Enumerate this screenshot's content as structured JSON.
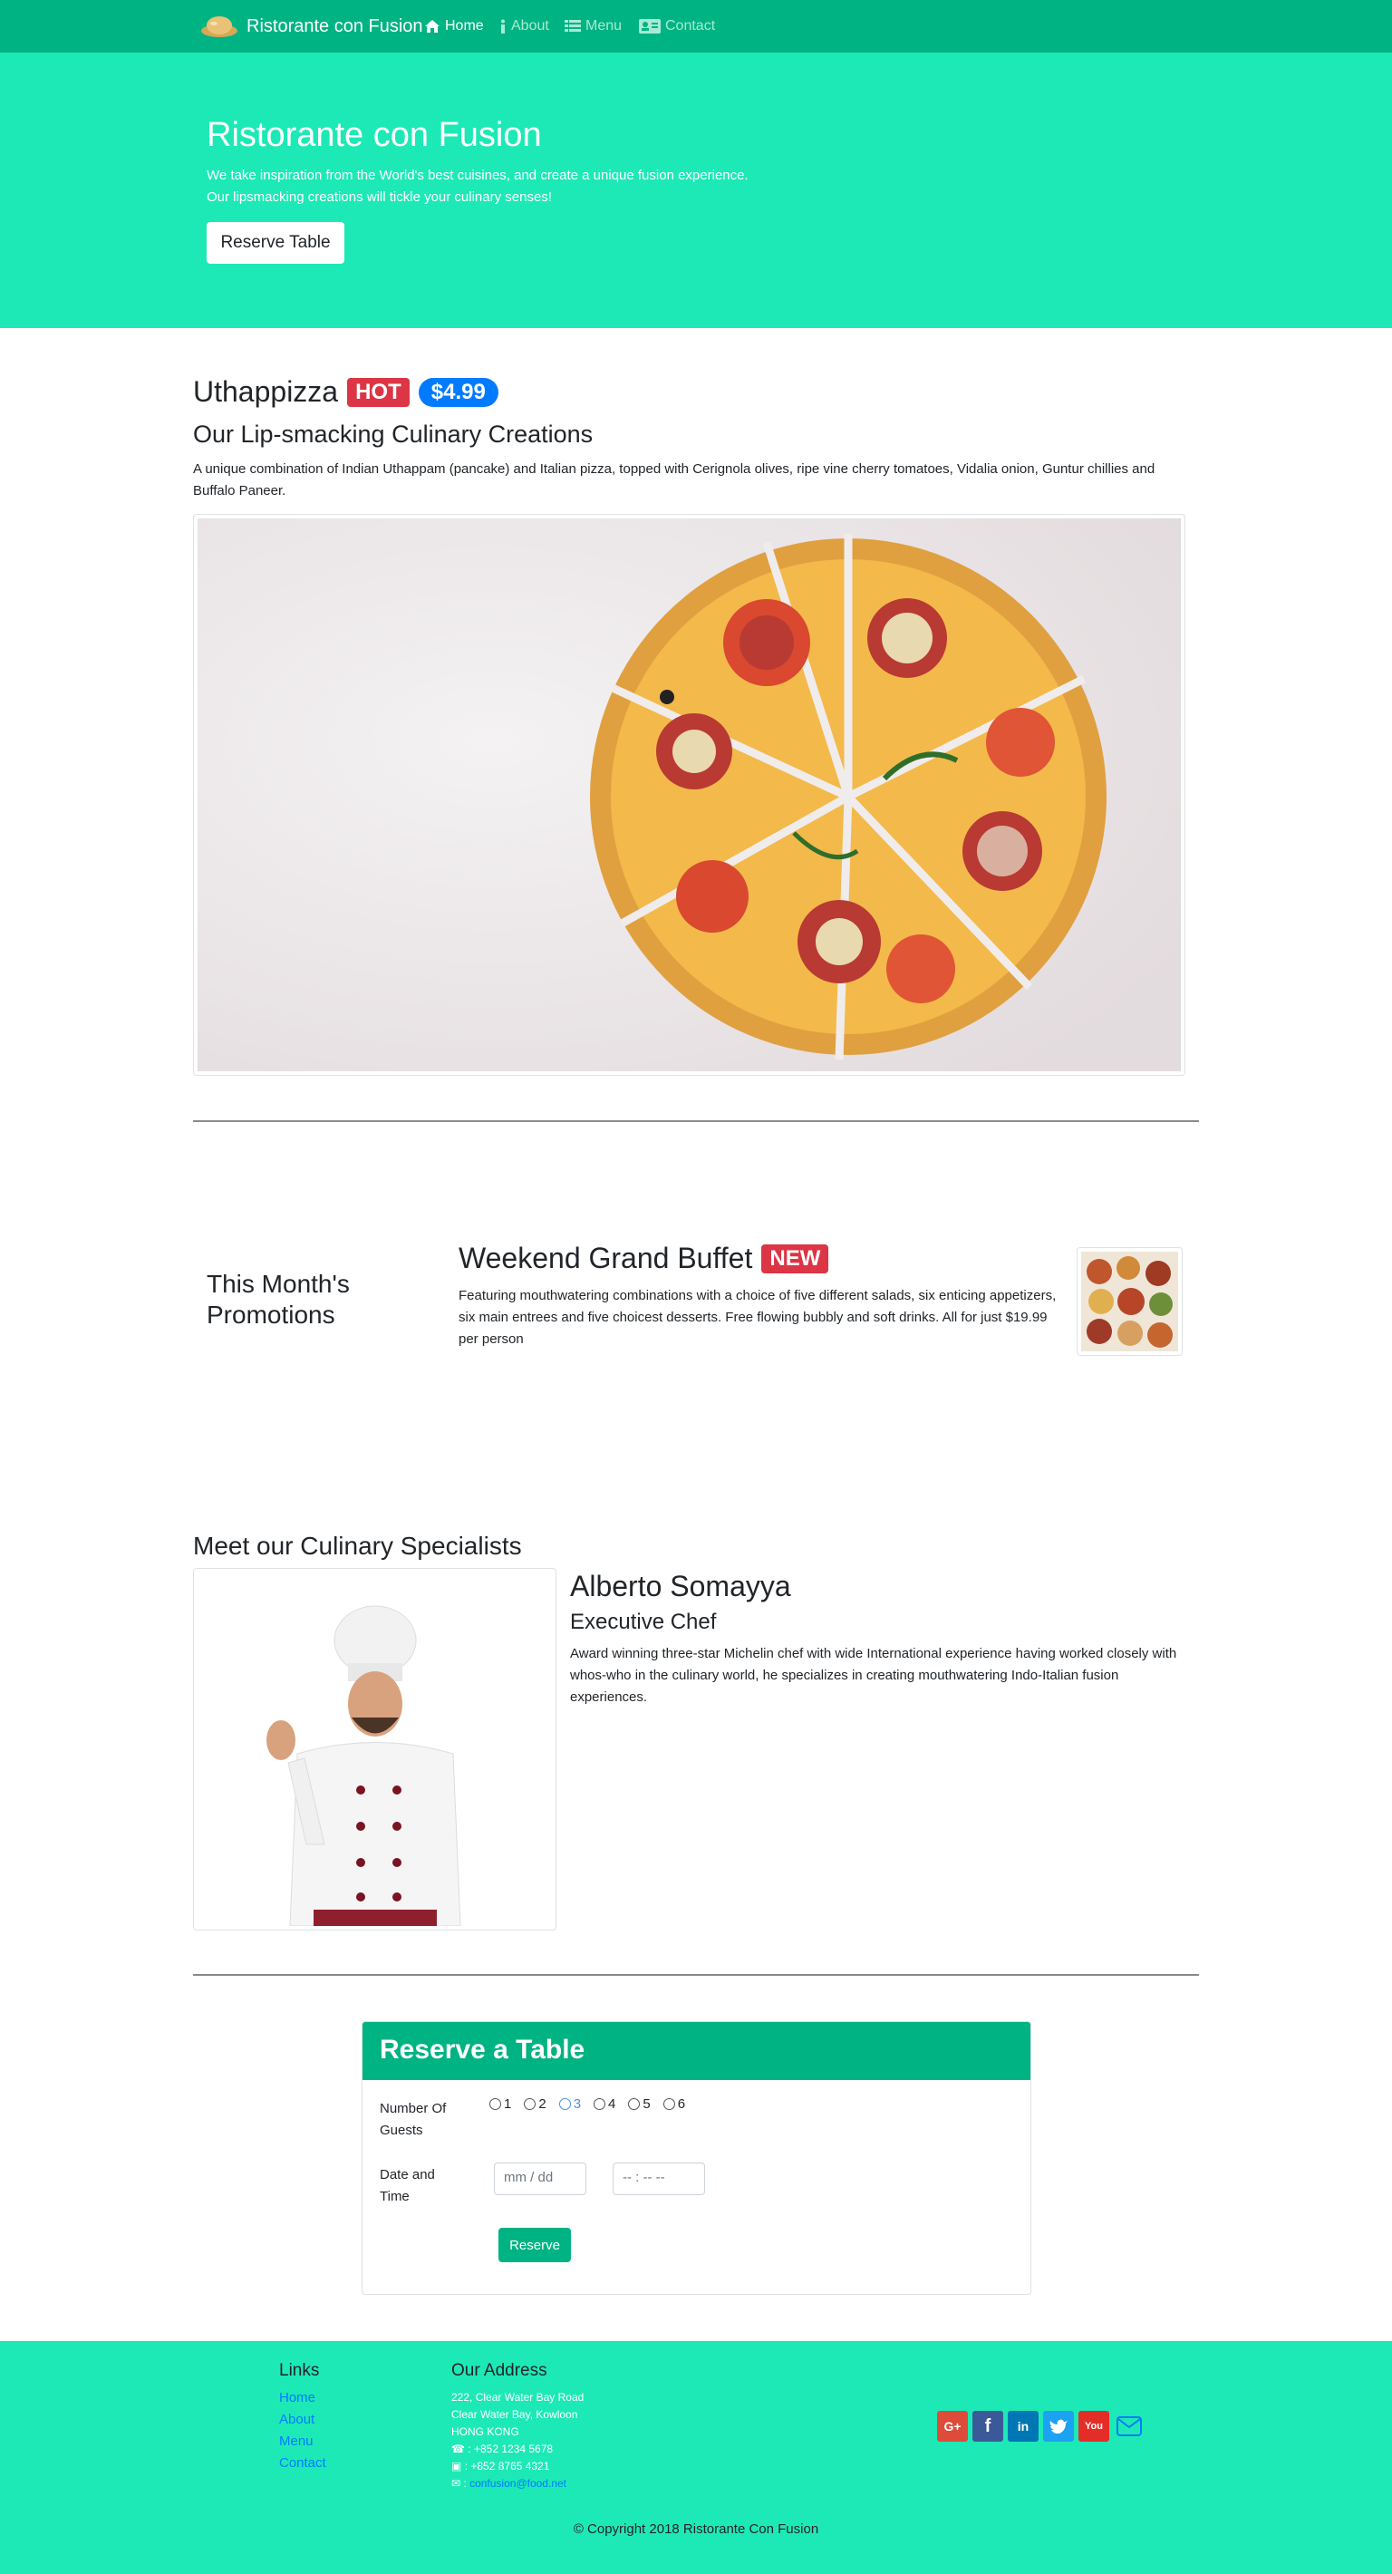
{
  "navbar": {
    "brand": "Ristorante con Fusion",
    "items": [
      {
        "label": "Home",
        "icon": "home-icon",
        "active": true
      },
      {
        "label": "About",
        "icon": "info-icon",
        "active": false
      },
      {
        "label": "Menu",
        "icon": "list-icon",
        "active": false
      },
      {
        "label": "Contact",
        "icon": "address-card-icon",
        "active": false
      }
    ]
  },
  "jumbotron": {
    "title": "Ristorante con Fusion",
    "line1": "We take inspiration from the World's best cuisines, and create a unique fusion experience.",
    "line2": "Our lipsmacking creations will tickle your culinary senses!",
    "button": "Reserve Table"
  },
  "dish": {
    "name": "Uthappizza",
    "badge": "HOT",
    "price": "$4.99",
    "subtitle": "Our Lip-smacking Culinary Creations",
    "description": "A unique combination of Indian Uthappam (pancake) and Italian pizza, topped with Cerignola olives, ripe vine cherry tomatoes, Vidalia onion, Guntur chillies and Buffalo Paneer."
  },
  "promotion": {
    "heading": "This Month's Promotions",
    "title": "Weekend Grand Buffet",
    "badge": "NEW",
    "description": "Featuring mouthwatering combinations with a choice of five different salads, six enticing appetizers, six main entrees and five choicest desserts. Free flowing bubbly and soft drinks. All for just $19.99 per person"
  },
  "chef": {
    "heading": "Meet our Culinary Specialists",
    "name": "Alberto Somayya",
    "role": "Executive Chef",
    "description": "Award winning three-star Michelin chef with wide International experience having worked closely with whos-who in the culinary world, he specializes in creating mouthwatering Indo-Italian fusion experiences."
  },
  "reserve": {
    "title": "Reserve a Table",
    "guests_label": "Number Of Guests",
    "guests": [
      "1",
      "2",
      "3",
      "4",
      "5",
      "6"
    ],
    "guests_selected": "3",
    "datetime_label": "Date and Time",
    "date_placeholder": "mm / dd",
    "time_placeholder": "-- : --   --",
    "submit": "Reserve"
  },
  "footer": {
    "links_heading": "Links",
    "links": [
      "Home",
      "About",
      "Menu",
      "Contact"
    ],
    "address_heading": "Our Address",
    "address": [
      "222, Clear Water Bay Road",
      "Clear Water Bay, Kowloon",
      "HONG KONG"
    ],
    "phone": ": +852 1234 5678",
    "fax": ": +852 8765 4321",
    "email": "confusion@food.net",
    "social": [
      "google-plus-icon",
      "facebook-icon",
      "linkedin-icon",
      "twitter-icon",
      "youtube-icon",
      "mail-icon"
    ],
    "copyright": "© Copyright 2018 Ristorante Con Fusion"
  },
  "colors": {
    "navbar": "#00b383",
    "jumbotron": "#1de9b6",
    "hot_badge": "#dc3545",
    "price_badge": "#007bff",
    "link": "#007bff"
  }
}
